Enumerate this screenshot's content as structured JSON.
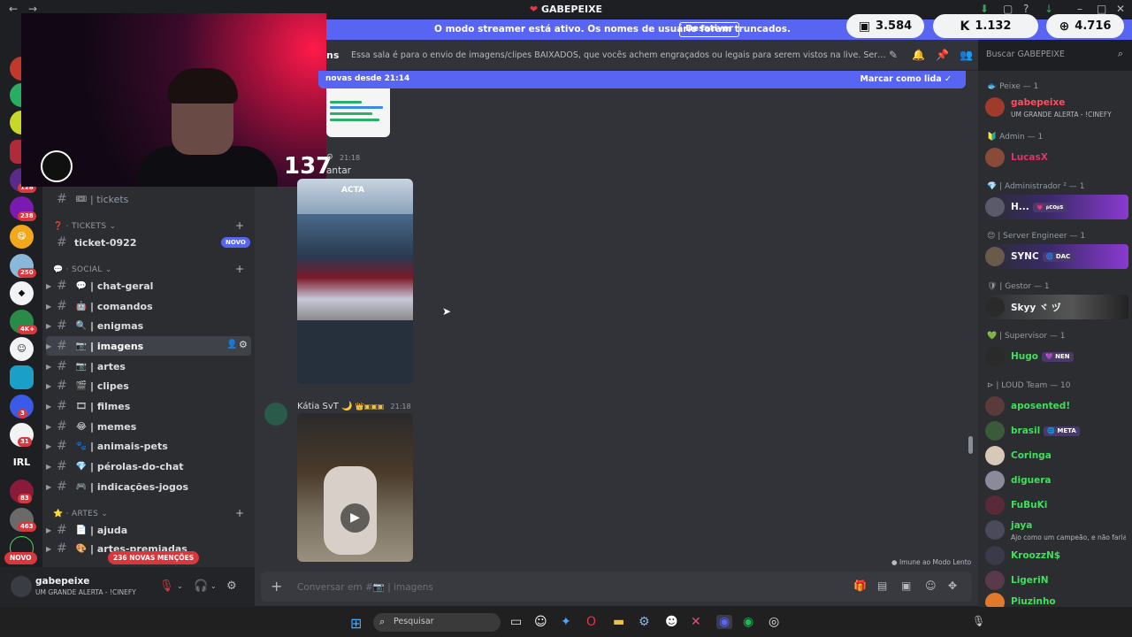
{
  "window": {
    "title": "GABEPEIXE"
  },
  "banner": {
    "text": "O modo streamer está ativo. Os nomes de usuário foram truncados.",
    "button": "Desativar"
  },
  "stats": [
    {
      "icon": "twitch-icon",
      "value": "3.584"
    },
    {
      "icon": "kick-icon",
      "value": "1.132"
    },
    {
      "icon": "globe-icon",
      "value": "4.716"
    }
  ],
  "webcam": {
    "counter": "137"
  },
  "server_badges": [
    "128",
    "238",
    "250",
    "4K+",
    "3",
    "31",
    "83",
    "463"
  ],
  "channels": {
    "top_channel": "| tickets",
    "tickets_category": "TICKETS",
    "ticket_channel": "ticket-0922",
    "new_label": "NOVO",
    "social_category": "SOCIAL",
    "social": [
      {
        "emoji": "💬",
        "name": "| chat-geral"
      },
      {
        "emoji": "🤖",
        "name": "| comandos"
      },
      {
        "emoji": "🔍",
        "name": "| enigmas"
      },
      {
        "emoji": "📷",
        "name": "| imagens",
        "active": true
      },
      {
        "emoji": "📷",
        "name": "| artes"
      },
      {
        "emoji": "🎬",
        "name": "| clipes"
      },
      {
        "emoji": "🎞",
        "name": "| filmes"
      },
      {
        "emoji": "😂",
        "name": "| memes"
      },
      {
        "emoji": "🐾",
        "name": "| animais-pets"
      },
      {
        "emoji": "💎",
        "name": "| pérolas-do-chat"
      },
      {
        "emoji": "🎮",
        "name": "| indicações-jogos"
      }
    ],
    "artes_category": "ARTES",
    "artes": [
      {
        "emoji": "📄",
        "name": "| ajuda"
      },
      {
        "emoji": "🎨",
        "name": "| artes-premiadas"
      }
    ]
  },
  "mentions": {
    "novo": "NOVO",
    "count_label": "236 NOVAS MENÇÕES"
  },
  "user_panel": {
    "name": "gabepeixe",
    "status": "UM GRANDE ALERTA - !CINEFY"
  },
  "header": {
    "channel_name": "ns",
    "topic": "Essa sala é para o envio de imagens/clipes BAIXADOS, que vocês achem engraçados ou legais para serem vistos na live. Serão apagados prints de o...",
    "search_placeholder": "Buscar GABEPEIXE"
  },
  "new_messages": {
    "text": "novas desde 21:14",
    "mark_read": "Marcar como lida"
  },
  "messages": [
    {
      "time": "21:18",
      "text": "antar"
    },
    {
      "author": "Kátia SvT 🌙",
      "time": "21:18"
    }
  ],
  "photo_label": "ACTA",
  "slow_mode": "Imune ao Modo Lento",
  "composer": {
    "placeholder": "Conversar em #📷 | imagens"
  },
  "members": {
    "groups": [
      {
        "role": "Peixe — 1",
        "members": [
          {
            "name": "gabepeixe",
            "color": "#ff4d5a",
            "sub": "UM GRANDE ALERTA - !CINEFY"
          }
        ]
      },
      {
        "role": "Admin — 1",
        "members": [
          {
            "name": "LucasX",
            "color": "#e5306a"
          }
        ]
      },
      {
        "role": "| Administrador ² — 1",
        "members": [
          {
            "name": "H...",
            "color": "#f2f3f5",
            "tag": "💗 ᵦcoᵦs",
            "banner": true
          }
        ]
      },
      {
        "role": "| Server Engineer — 1",
        "members": [
          {
            "name": "SYNC",
            "color": "#f2f3f5",
            "tag": "🌀 DAC",
            "banner": true
          }
        ]
      },
      {
        "role": "| Gestor — 1",
        "members": [
          {
            "name": "Skyy ヾ ヅ",
            "color": "#f2f3f5",
            "banner2": true
          }
        ]
      },
      {
        "role": "| Supervisor — 1",
        "members": [
          {
            "name": "Hugo",
            "color": "#3ee05a",
            "tag": "💜 NEN"
          }
        ]
      },
      {
        "role": "| LOUD Team — 10",
        "members": [
          {
            "name": "aposented!",
            "color": "#3ee05a"
          },
          {
            "name": "brasil",
            "color": "#3ee05a",
            "tag": "🌐 META"
          },
          {
            "name": "Coringa",
            "color": "#3ee05a"
          },
          {
            "name": "diguera",
            "color": "#3ee05a"
          },
          {
            "name": "FuBuKi",
            "color": "#3ee05a"
          },
          {
            "name": "jaya",
            "color": "#3ee05a",
            "sub": "Ajo como um campeão, e não faria..."
          },
          {
            "name": "KroozzN$",
            "color": "#3ee05a"
          },
          {
            "name": "LigeriN",
            "color": "#3ee05a"
          },
          {
            "name": "Piuzinho",
            "color": "#3ee05a"
          }
        ]
      }
    ]
  },
  "taskbar": {
    "search_placeholder": "Pesquisar"
  }
}
